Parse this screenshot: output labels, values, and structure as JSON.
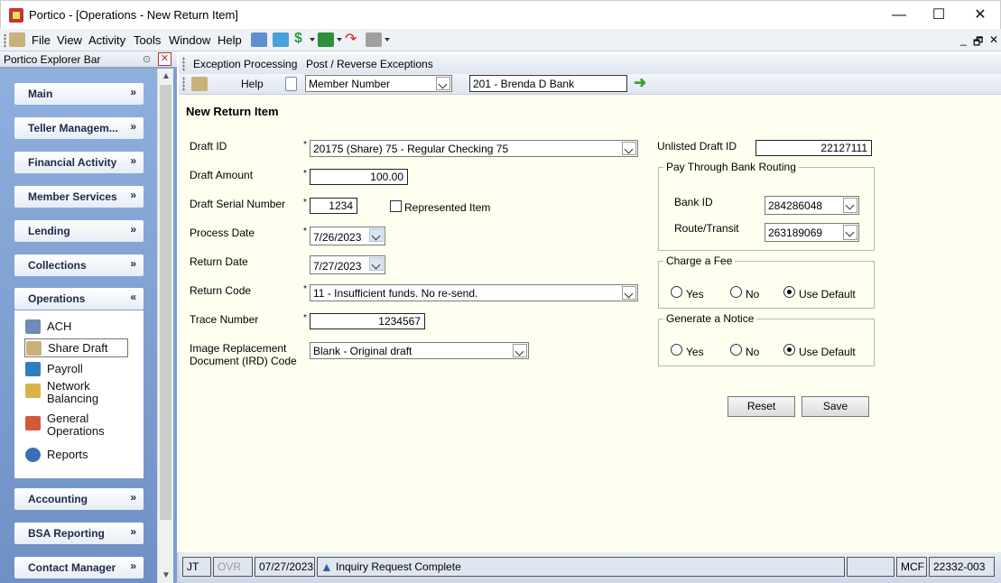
{
  "window": {
    "title": "Portico - [Operations - New Return Item]",
    "minimize": "—",
    "maximize": "☐",
    "close": "✕"
  },
  "menu": {
    "items": [
      "File",
      "View",
      "Activity",
      "Tools",
      "Window",
      "Help"
    ],
    "mdi_min": "_",
    "mdi_restore": "🗗",
    "mdi_close": "✕"
  },
  "explorer": {
    "title": "Portico Explorer Bar",
    "groups": [
      "Main",
      "Teller Managem...",
      "Financial Activity",
      "Member Services",
      "Lending",
      "Collections",
      "Operations",
      "Accounting",
      "BSA Reporting",
      "Contact Manager"
    ],
    "operations_items": [
      "ACH",
      "Share Draft",
      "Payroll",
      "Network Balancing",
      "General Operations",
      "Reports"
    ],
    "selected_item": "Share Draft"
  },
  "toolbar1": {
    "exception_processing": "Exception Processing",
    "post_reverse": "Post / Reverse Exceptions"
  },
  "toolbar2": {
    "help": "Help",
    "search_type": "Member Number",
    "member": "201 - Brenda D Bank"
  },
  "form": {
    "title": "New Return Item",
    "draft_id_label": "Draft ID",
    "draft_id_value": "20175 (Share) 75 - Regular Checking 75",
    "draft_amount_label": "Draft Amount",
    "draft_amount_value": "100.00",
    "serial_label": "Draft Serial Number",
    "serial_value": "1234",
    "represented_label": "Represented Item",
    "represented_checked": false,
    "process_date_label": "Process Date",
    "process_date_value": "7/26/2023",
    "return_date_label": "Return Date",
    "return_date_value": "7/27/2023",
    "return_code_label": "Return Code",
    "return_code_value": "11 - Insufficient funds. No re-send.",
    "trace_label": "Trace Number",
    "trace_value": "1234567",
    "ird_label_1": "Image Replacement",
    "ird_label_2": "Document (IRD) Code",
    "ird_value": "Blank - Original draft",
    "unlisted_label": "Unlisted Draft ID",
    "unlisted_value": "22127111",
    "routing_legend": "Pay Through Bank Routing",
    "bank_id_label": "Bank ID",
    "bank_id_value": "284286048",
    "route_label": "Route/Transit",
    "route_value": "263189069",
    "fee_legend": "Charge a Fee",
    "notice_legend": "Generate a Notice",
    "opt_yes": "Yes",
    "opt_no": "No",
    "opt_default": "Use Default",
    "fee_selected": "Use Default",
    "notice_selected": "Use Default",
    "reset": "Reset",
    "save": "Save",
    "required_mark": "*"
  },
  "status": {
    "user": "JT",
    "ovr": "OVR",
    "date": "07/27/2023",
    "message": "Inquiry Request Complete",
    "blank": "",
    "mcf": "MCF",
    "code": "22332-003"
  },
  "colors": {
    "form_bg": "#fffff0",
    "explorer_bg": "#7c9fd1",
    "status_bg": "#dfe6f0"
  }
}
